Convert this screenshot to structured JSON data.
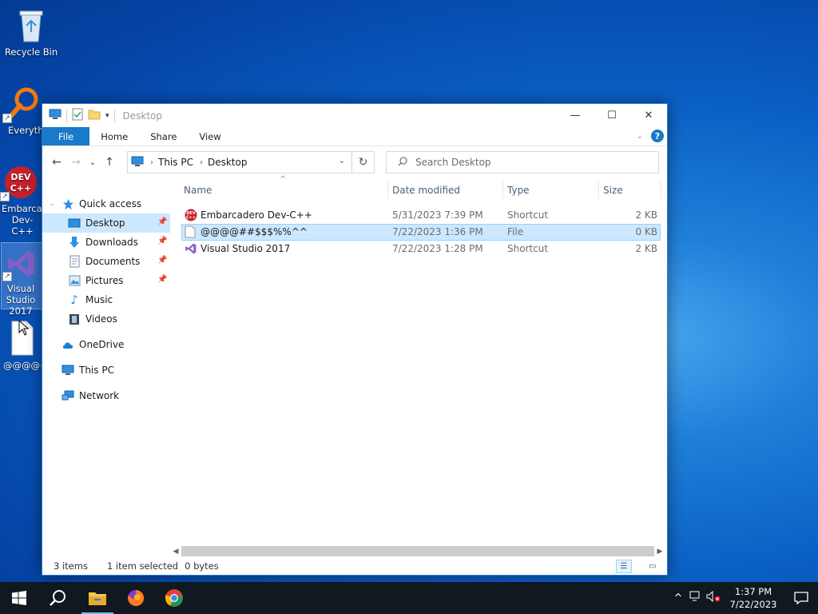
{
  "desktop": {
    "icons": [
      {
        "label": "Recycle Bin"
      },
      {
        "label": "Everything"
      },
      {
        "label": "Embarcadero Dev-C++"
      },
      {
        "label": "Visual Studio 2017"
      },
      {
        "label": "@@@@##$$$%%^^"
      }
    ]
  },
  "window": {
    "title": "Desktop",
    "controls": {
      "minimize": "—",
      "maximize": "☐",
      "close": "✕"
    }
  },
  "ribbon": {
    "tabs": [
      "File",
      "Home",
      "Share",
      "View"
    ],
    "help": "?"
  },
  "nav": {
    "back": "←",
    "forward": "→",
    "recent": "⌄",
    "up": "↑",
    "breadcrumb": [
      "This PC",
      "Desktop"
    ],
    "refresh": "↻",
    "search_placeholder": "Search Desktop"
  },
  "navpane": {
    "quick_access": "Quick access",
    "items": [
      {
        "label": "Desktop",
        "pinned": true
      },
      {
        "label": "Downloads",
        "pinned": true
      },
      {
        "label": "Documents",
        "pinned": true
      },
      {
        "label": "Pictures",
        "pinned": true
      },
      {
        "label": "Music",
        "pinned": false
      },
      {
        "label": "Videos",
        "pinned": false
      }
    ],
    "onedrive": "OneDrive",
    "thispc": "This PC",
    "network": "Network"
  },
  "columns": {
    "name": "Name",
    "date": "Date modified",
    "type": "Type",
    "size": "Size"
  },
  "files": [
    {
      "name": "Embarcadero Dev-C++",
      "date": "5/31/2023 7:39 PM",
      "type": "Shortcut",
      "size": "2 KB",
      "selected": false
    },
    {
      "name": "@@@@##$$$%%^^",
      "date": "7/22/2023 1:36 PM",
      "type": "File",
      "size": "0 KB",
      "selected": true
    },
    {
      "name": "Visual Studio 2017",
      "date": "7/22/2023 1:28 PM",
      "type": "Shortcut",
      "size": "2 KB",
      "selected": false
    }
  ],
  "status": {
    "count": "3 items",
    "selection": "1 item selected",
    "size": "0 bytes"
  },
  "taskbar": {
    "time": "1:37 PM",
    "date": "7/22/2023"
  },
  "colors": {
    "accent": "#1979ca",
    "selection": "#cce8ff",
    "taskbar": "#101820"
  }
}
